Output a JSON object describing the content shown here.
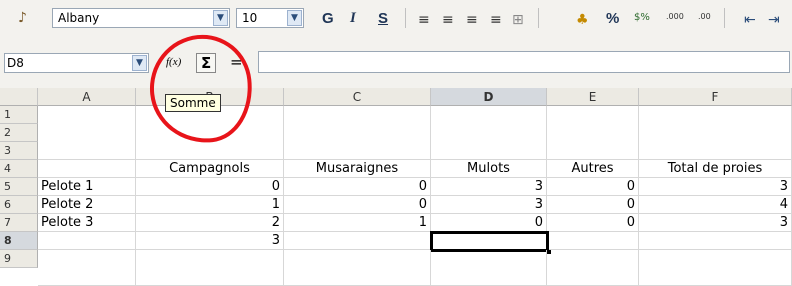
{
  "toolbar": {
    "font_name": "Albany",
    "font_size": "10",
    "bold_label": "G",
    "italic_label": "I",
    "underline_label": "S",
    "percent_label": "%",
    "currency_label": "$%",
    "decimal_add_label": ".000",
    "decimal_remove_label": ".00"
  },
  "formula_bar": {
    "cell_ref": "D8",
    "function_label": "f(x)",
    "sum_label": "Σ",
    "equals_label": "=",
    "formula_value": "",
    "tooltip": "Somme"
  },
  "grid": {
    "columns": [
      "A",
      "B",
      "C",
      "D",
      "E",
      "F"
    ],
    "selected_column": "D",
    "rows": [
      "1",
      "2",
      "3",
      "4",
      "5",
      "6",
      "7",
      "8",
      "9"
    ],
    "selected_row": "8",
    "headers": [
      "",
      "Campagnols",
      "Musaraignes",
      "Mulots",
      "Autres",
      "Total de proies"
    ],
    "data": [
      [
        "Pelote 1",
        "0",
        "0",
        "3",
        "0",
        "3"
      ],
      [
        "Pelote 2",
        "1",
        "0",
        "3",
        "0",
        "4"
      ],
      [
        "Pelote 3",
        "2",
        "1",
        "0",
        "0",
        "3"
      ],
      [
        "",
        "3",
        "",
        "",
        "",
        ""
      ]
    ]
  },
  "colors": {
    "annotation": "#e8141a",
    "header_bg": "#eceae3",
    "selected_header_bg": "#d5d9de"
  }
}
